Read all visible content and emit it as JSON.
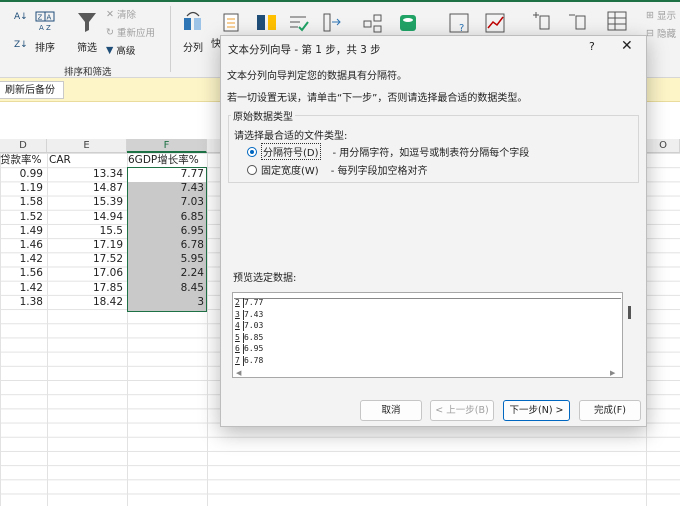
{
  "ribbon": {
    "sort_label": "排序",
    "filter_label": "筛选",
    "clear_label": "清除",
    "reapply_label": "重新应用",
    "advanced_label": "高级",
    "sort_filter_group": "排序和筛选",
    "split_label": "分列",
    "quick_label": "快",
    "show_detail_label": "显示",
    "hide_detail_label": "隐藏"
  },
  "infobar": {
    "button_label": "刷新后备份"
  },
  "sheet": {
    "columns": [
      "D",
      "E",
      "F",
      "O"
    ],
    "headers": {
      "D": "贷款率%",
      "E": "CAR",
      "F": "6GDP增长率%"
    },
    "rows": [
      {
        "d": "0.99",
        "e": "13.34",
        "f": "7.77"
      },
      {
        "d": "1.19",
        "e": "14.87",
        "f": "7.43"
      },
      {
        "d": "1.58",
        "e": "15.39",
        "f": "7.03"
      },
      {
        "d": "1.52",
        "e": "14.94",
        "f": "6.85"
      },
      {
        "d": "1.49",
        "e": "15.5",
        "f": "6.95"
      },
      {
        "d": "1.46",
        "e": "17.19",
        "f": "6.78"
      },
      {
        "d": "1.42",
        "e": "17.52",
        "f": "5.95"
      },
      {
        "d": "1.56",
        "e": "17.06",
        "f": "2.24"
      },
      {
        "d": "1.42",
        "e": "17.85",
        "f": "8.45"
      },
      {
        "d": "1.38",
        "e": "18.42",
        "f": "3"
      }
    ]
  },
  "dialog": {
    "title": "文本分列向导 - 第 1 步，共 3 步",
    "help": "?",
    "close": "✕",
    "line1": "文本分列向导判定您的数据具有分隔符。",
    "line2": "若一切设置无误，请单击“下一步”，否则请选择最合适的数据类型。",
    "group_title": "原始数据类型",
    "choose_label": "请选择最合适的文件类型:",
    "option_delimited": "分隔符号(D)",
    "option_delimited_desc": "- 用分隔字符，如逗号或制表符分隔每个字段",
    "option_fixed": "固定宽度(W)",
    "option_fixed_desc": "- 每列字段加空格对齐",
    "selected_option": "delimited",
    "preview_label": "预览选定数据:",
    "preview_rows": [
      {
        "n": "2",
        "v": "7.77"
      },
      {
        "n": "3",
        "v": "7.43"
      },
      {
        "n": "4",
        "v": "7.03"
      },
      {
        "n": "5",
        "v": "6.85"
      },
      {
        "n": "6",
        "v": "6.95"
      },
      {
        "n": "7",
        "v": "6.78"
      }
    ],
    "cancel": "取消",
    "back": "< 上一步(B)",
    "next": "下一步(N) >",
    "finish": "完成(F)"
  }
}
